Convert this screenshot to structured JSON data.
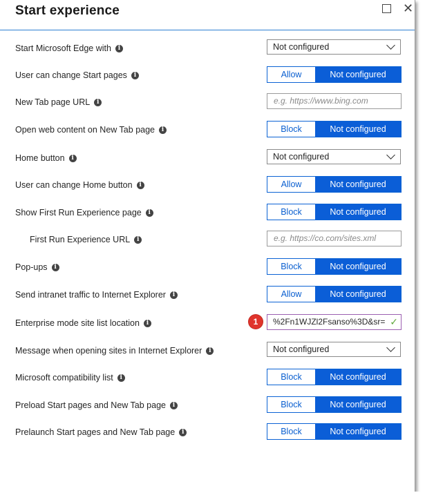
{
  "panel": {
    "title": "Start experience"
  },
  "settings": [
    {
      "label": "Start Microsoft Edge with",
      "type": "select",
      "value": "Not configured"
    },
    {
      "label": "User can change Start pages",
      "type": "toggle",
      "option_a": "Allow",
      "option_b": "Not configured"
    },
    {
      "label": "New Tab page URL",
      "type": "input",
      "placeholder": "e.g. https://www.bing.com"
    },
    {
      "label": "Open web content on New Tab page",
      "type": "toggle",
      "option_a": "Block",
      "option_b": "Not configured"
    },
    {
      "label": "Home button",
      "type": "select",
      "value": "Not configured"
    },
    {
      "label": "User can change Home button",
      "type": "toggle",
      "option_a": "Allow",
      "option_b": "Not configured"
    },
    {
      "label": "Show First Run Experience page",
      "type": "toggle",
      "option_a": "Block",
      "option_b": "Not configured"
    },
    {
      "label": "First Run Experience URL",
      "type": "input",
      "placeholder": "e.g. https://co.com/sites.xml"
    },
    {
      "label": "Pop-ups",
      "type": "toggle",
      "option_a": "Block",
      "option_b": "Not configured"
    },
    {
      "label": "Send intranet traffic to Internet Explorer",
      "type": "toggle",
      "option_a": "Allow",
      "option_b": "Not configured"
    },
    {
      "label": "Enterprise mode site list location",
      "type": "input",
      "value": "%2Fn1WJZl2Fsanso%3D&sr="
    },
    {
      "label": "Message when opening sites in Internet Explorer",
      "type": "select",
      "value": "Not configured"
    },
    {
      "label": "Microsoft compatibility list",
      "type": "toggle",
      "option_a": "Block",
      "option_b": "Not configured"
    },
    {
      "label": "Preload Start pages and New Tab page",
      "type": "toggle",
      "option_a": "Block",
      "option_b": "Not configured"
    },
    {
      "label": "Prelaunch Start pages and New Tab page",
      "type": "toggle",
      "option_a": "Block",
      "option_b": "Not configured"
    }
  ],
  "callout": {
    "number": "1"
  },
  "colors": {
    "accent": "#0b5ed7",
    "callout": "#e0342c",
    "valid_border": "#9b5eb0",
    "check": "#5fa83a"
  },
  "icons": {
    "info": "info-icon",
    "maximize": "maximize-icon",
    "close": "close-icon",
    "check": "checkmark-icon",
    "chevron": "chevron-down-icon"
  }
}
